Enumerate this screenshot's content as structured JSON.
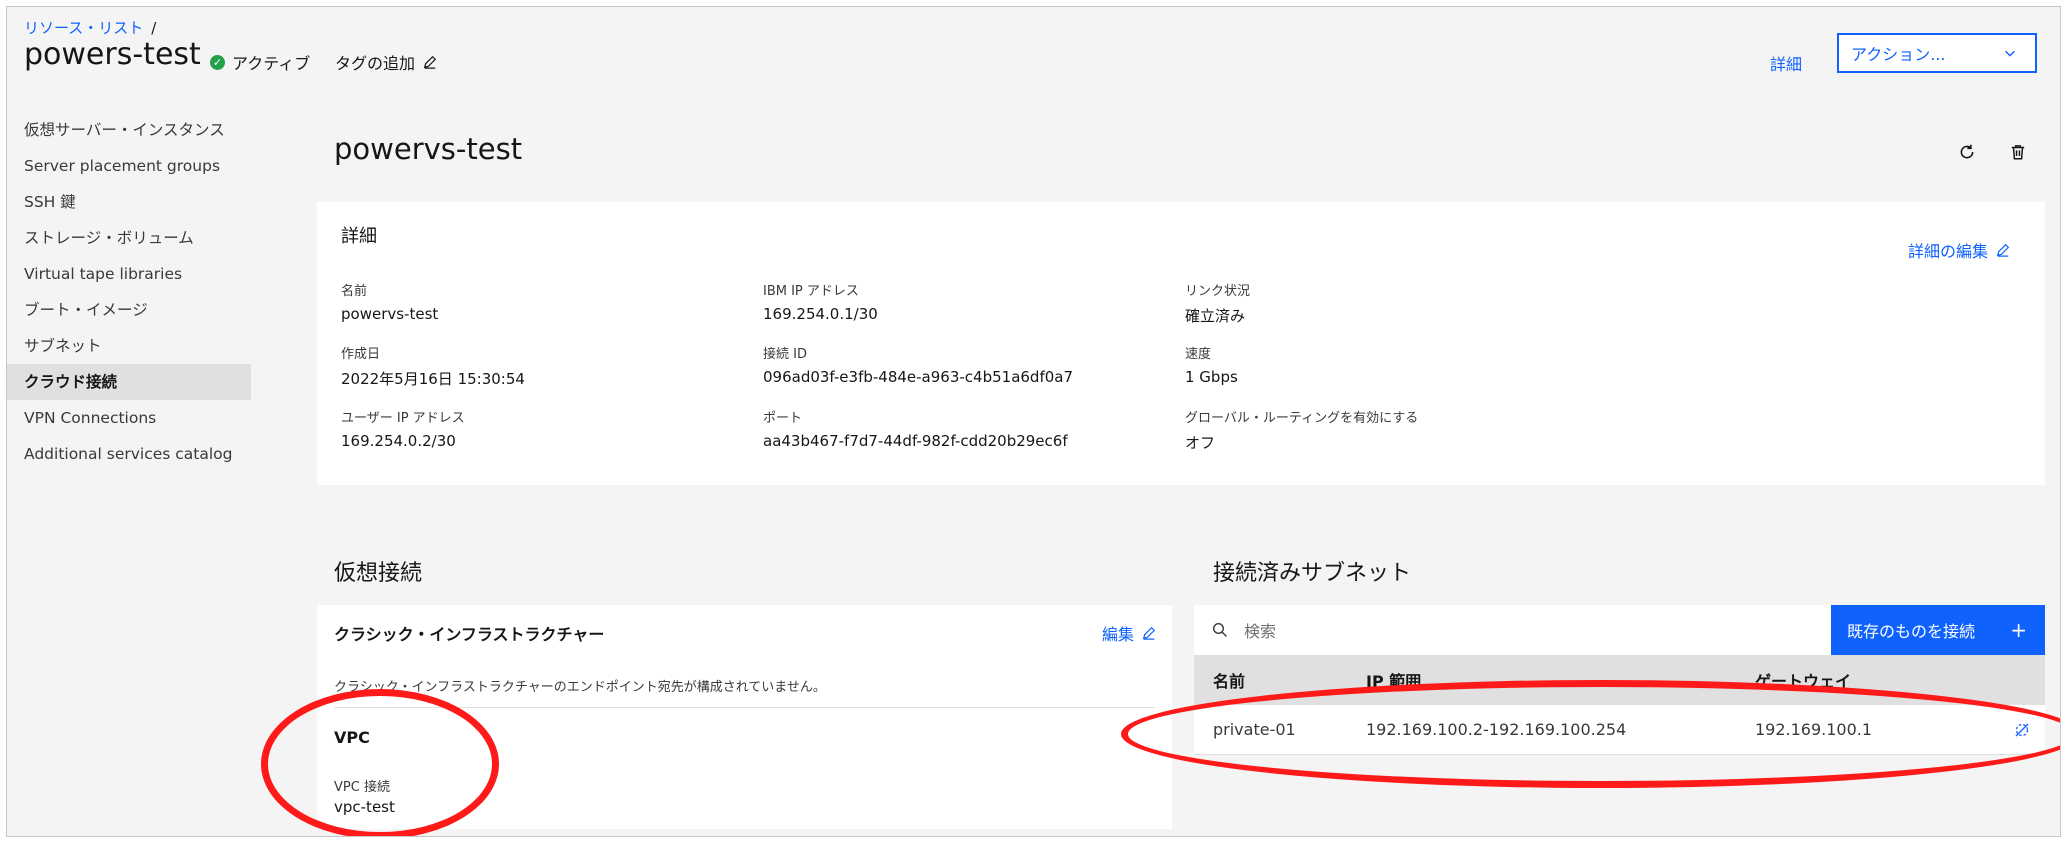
{
  "header": {
    "breadcrumb": "リソース・リスト",
    "breadcrumb_sep": "/",
    "title": "powers-test",
    "status": "アクティブ",
    "add_tag": "タグの追加",
    "details_link": "詳細",
    "action_dropdown": "アクション..."
  },
  "sidebar": {
    "items": [
      {
        "label": "仮想サーバー・インスタンス"
      },
      {
        "label": "Server placement groups"
      },
      {
        "label": "SSH 鍵"
      },
      {
        "label": "ストレージ・ボリューム"
      },
      {
        "label": "Virtual tape libraries"
      },
      {
        "label": "ブート・イメージ"
      },
      {
        "label": "サブネット"
      },
      {
        "label": "クラウド接続",
        "active": true
      },
      {
        "label": "VPN Connections"
      },
      {
        "label": "Additional services catalog"
      }
    ]
  },
  "resource": {
    "title": "powervs-test",
    "icons": [
      "refresh-icon",
      "trash-icon"
    ]
  },
  "details": {
    "heading": "詳細",
    "edit_link": "詳細の編集",
    "fields": {
      "name": {
        "label": "名前",
        "value": "powervs-test"
      },
      "created": {
        "label": "作成日",
        "value": "2022年5月16日 15:30:54"
      },
      "user_ip": {
        "label": "ユーザー IP アドレス",
        "value": "169.254.0.2/30"
      },
      "ibm_ip": {
        "label": "IBM IP アドレス",
        "value": "169.254.0.1/30"
      },
      "connection_id": {
        "label": "接続 ID",
        "value": "096ad03f-e3fb-484e-a963-c4b51a6df0a7"
      },
      "port": {
        "label": "ポート",
        "value": "aa43b467-f7d7-44df-982f-cdd20b29ec6f"
      },
      "link_status": {
        "label": "リンク状況",
        "value": "確立済み"
      },
      "speed": {
        "label": "速度",
        "value": "1 Gbps"
      },
      "global_routing": {
        "label": "グローバル・ルーティングを有効にする",
        "value": "オフ"
      }
    }
  },
  "virtual_connection": {
    "section_title": "仮想接続",
    "classic_heading": "クラシック・インフラストラクチャー",
    "edit_label": "編集",
    "classic_message": "クラシック・インフラストラクチャーのエンドポイント宛先が構成されていません。",
    "vpc_heading": "VPC",
    "vpc_label": "VPC 接続",
    "vpc_value": "vpc-test"
  },
  "subnets": {
    "section_title": "接続済みサブネット",
    "search_placeholder": "検索",
    "attach_button": "既存のものを接続",
    "columns": [
      "名前",
      "IP 範囲",
      "ゲートウェイ"
    ],
    "rows": [
      {
        "name": "private-01",
        "ip_range": "192.169.100.2-192.169.100.254",
        "gateway": "192.169.100.1"
      }
    ]
  },
  "colors": {
    "accent": "#0f62fe",
    "status_green": "#24a148",
    "annotation_red": "#ff1a1a"
  }
}
